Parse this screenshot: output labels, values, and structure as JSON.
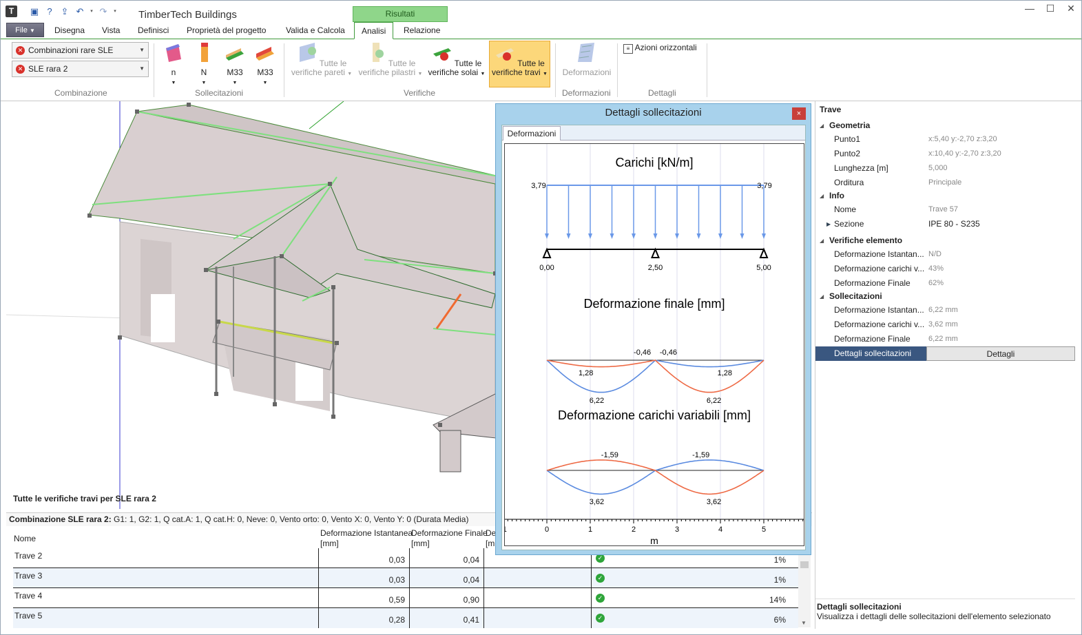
{
  "app": {
    "title": "TimberTech Buildings",
    "logo": "T",
    "context_tab": "Risultati"
  },
  "window_controls": {
    "minimize": "—",
    "maximize": "☐",
    "close": "✕"
  },
  "menu": {
    "file": "File",
    "tabs": [
      "Disegna",
      "Vista",
      "Definisci",
      "Proprietà del progetto",
      "Valida e Calcola",
      "Analisi",
      "Relazione"
    ],
    "active": "Analisi"
  },
  "ribbon": {
    "combinazione": {
      "combo1": "Combinazioni rare SLE",
      "combo2": "SLE rara 2",
      "label": "Combinazione"
    },
    "sollecitazioni": {
      "buttons": [
        "n",
        "N",
        "M33",
        "M33"
      ],
      "label": "Sollecitazioni"
    },
    "verifiche": {
      "pareti": [
        "Tutte le",
        "verifiche pareti"
      ],
      "pilastri": [
        "Tutte le",
        "verifiche pilastri"
      ],
      "solai": [
        "Tutte le",
        "verifiche solai"
      ],
      "travi": [
        "Tutte le",
        "verifiche travi"
      ],
      "label": "Verifiche"
    },
    "deformazioni": {
      "button": "Deformazioni",
      "label": "Deformazioni"
    },
    "dettagli": {
      "button": "Azioni orizzontali",
      "label": "Dettagli"
    }
  },
  "view": {
    "caption": "Tutte le verifiche travi per SLE rara 2"
  },
  "combination_line": {
    "bold": "Combinazione SLE rara 2:",
    "text": "G1: 1, G2: 1, Q cat.A: 1, Q cat.H: 0, Neve: 0, Vento orto: 0, Vento X: 0, Vento Y: 0 (Durata Media)"
  },
  "table": {
    "headers": [
      "Nome",
      "Deformazione Istantanea",
      "[mm]",
      "Deformazione Finale",
      "[mm]",
      "De",
      "[m"
    ],
    "rows": [
      {
        "name": "Trave 2",
        "ist": "0,03",
        "fin": "0,04",
        "pct": "1%"
      },
      {
        "name": "Trave 3",
        "ist": "0,03",
        "fin": "0,04",
        "pct": "1%"
      },
      {
        "name": "Trave 4",
        "ist": "0,59",
        "fin": "0,90",
        "pct": "14%"
      },
      {
        "name": "Trave 5",
        "ist": "0,28",
        "fin": "0,41",
        "pct": "6%"
      }
    ]
  },
  "dialog": {
    "title": "Dettagli sollecitazioni",
    "tab": "Deformazioni",
    "close": "×",
    "chart_titles": [
      "Carichi [kN/m]",
      "Deformazione finale [mm]",
      "Deformazione carichi variabili [mm]"
    ],
    "load_labels": [
      "3,79",
      "3,79"
    ],
    "support_labels": [
      "0,00",
      "2,50",
      "5,00"
    ],
    "final_labels": [
      "-0,46",
      "-0,46",
      "1,28",
      "1,28",
      "6,22",
      "6,22"
    ],
    "var_labels": [
      "-1,59",
      "-1,59",
      "3,62",
      "3,62"
    ],
    "x_ticks": [
      "-1",
      "0",
      "1",
      "2",
      "3",
      "4",
      "5",
      "6"
    ],
    "x_label": "m"
  },
  "chart_data": [
    {
      "type": "line",
      "title": "Carichi [kN/m]",
      "x": [
        0,
        5
      ],
      "series": [
        {
          "values": [
            3.79,
            3.79
          ]
        }
      ],
      "supports_x": [
        0.0,
        2.5,
        5.0
      ]
    },
    {
      "type": "line",
      "title": "Deformazione finale [mm]",
      "xlabel": "m",
      "x": [
        0,
        1.25,
        2.5,
        3.75,
        5
      ],
      "series": [
        {
          "values": [
            0,
            6.22,
            0,
            1.28,
            0
          ]
        },
        {
          "values": [
            0,
            1.28,
            0,
            6.22,
            0
          ]
        }
      ],
      "annotations": [
        "-0,46",
        "-0,46"
      ]
    },
    {
      "type": "line",
      "title": "Deformazione carichi variabili [mm]",
      "xlabel": "m",
      "x": [
        0,
        1.25,
        2.5,
        3.75,
        5
      ],
      "series": [
        {
          "values": [
            0,
            3.62,
            0,
            -1.59,
            0
          ]
        },
        {
          "values": [
            0,
            -1.59,
            0,
            3.62,
            0
          ]
        }
      ]
    }
  ],
  "properties": {
    "title": "Trave",
    "categories": {
      "geometria": "Geometria",
      "info": "Info",
      "verifiche": "Verifiche elemento",
      "sollecitazioni": "Sollecitazioni"
    },
    "geometria": [
      {
        "k": "Punto1",
        "v": "x:5,40 y:-2,70 z:3,20"
      },
      {
        "k": "Punto2",
        "v": "x:10,40 y:-2,70 z:3,20"
      },
      {
        "k": "Lunghezza [m]",
        "v": "5,000"
      },
      {
        "k": "Orditura",
        "v": "Principale"
      }
    ],
    "info": [
      {
        "k": "Nome",
        "v": "Trave 57"
      },
      {
        "k": "Sezione",
        "v": "IPE 80 - S235"
      }
    ],
    "verifiche": [
      {
        "k": "Deformazione Istantan...",
        "v": "N/D"
      },
      {
        "k": "Deformazione carichi v...",
        "v": "43%"
      },
      {
        "k": "Deformazione Finale",
        "v": "62%"
      }
    ],
    "sollecitazioni": [
      {
        "k": "Deformazione Istantan...",
        "v": "6,22 mm"
      },
      {
        "k": "Deformazione carichi v...",
        "v": "3,62 mm"
      },
      {
        "k": "Deformazione Finale",
        "v": "6,22 mm"
      }
    ],
    "selected": {
      "k": "Dettagli sollecitazioni",
      "button": "Dettagli"
    },
    "description": {
      "title": "Dettagli sollecitazioni",
      "text": "Visualizza i dettagli delle sollecitazioni dell'elemento selezionato"
    }
  }
}
